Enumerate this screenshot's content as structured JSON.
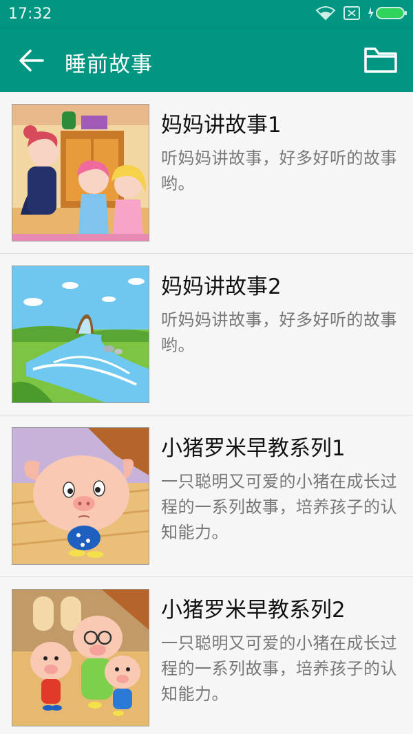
{
  "status_bar": {
    "time": "17:32",
    "icons": [
      "wifi-icon",
      "sim-off-icon",
      "battery-charging-icon"
    ]
  },
  "app_bar": {
    "title": "睡前故事",
    "back_icon": "arrow-back-icon",
    "action_icon": "folder-icon"
  },
  "colors": {
    "primary": "#009682",
    "background": "#f6f6f6",
    "title_text": "#111111",
    "desc_text": "#777777",
    "divider": "#dcdcdc"
  },
  "stories": [
    {
      "title": "妈妈讲故事1",
      "desc": "听妈妈讲故事，好多好听的故事哟。",
      "thumb": "mother-storytelling-image"
    },
    {
      "title": "妈妈讲故事2",
      "desc": "听妈妈讲故事，好多好听的故事哟。",
      "thumb": "river-landscape-image"
    },
    {
      "title": "小猪罗米早教系列1",
      "desc": "一只聪明又可爱的小猪在成长过程的一系列故事，培养孩子的认知能力。",
      "thumb": "piglet-image"
    },
    {
      "title": "小猪罗米早教系列2",
      "desc": "一只聪明又可爱的小猪在成长过程的一系列故事，培养孩子的认知能力。",
      "thumb": "pig-family-image"
    }
  ]
}
